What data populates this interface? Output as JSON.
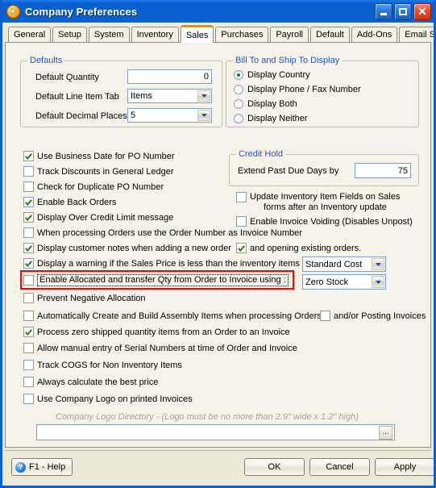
{
  "window": {
    "title": "Company Preferences",
    "app_icon": "play-circle-icon",
    "minimize_label": "Minimize",
    "maximize_label": "Maximize",
    "close_label": "Close"
  },
  "tabs": [
    {
      "label": "General",
      "active": false
    },
    {
      "label": "Setup",
      "active": false
    },
    {
      "label": "System",
      "active": false
    },
    {
      "label": "Inventory",
      "active": false
    },
    {
      "label": "Sales",
      "active": true
    },
    {
      "label": "Purchases",
      "active": false
    },
    {
      "label": "Payroll",
      "active": false
    },
    {
      "label": "Default",
      "active": false
    },
    {
      "label": "Add-Ons",
      "active": false
    },
    {
      "label": "Email Setup",
      "active": false
    }
  ],
  "defaults_group": {
    "legend": "Defaults",
    "quantity_label": "Default Quantity",
    "quantity_value": "0",
    "line_item_tab_label": "Default Line Item Tab",
    "line_item_tab_value": "Items",
    "decimal_places_label": "Default Decimal Places",
    "decimal_places_value": "5"
  },
  "billship_group": {
    "legend": "Bill To and Ship To Display",
    "options": [
      {
        "label": "Display Country",
        "selected": true
      },
      {
        "label": "Display Phone / Fax Number",
        "selected": false
      },
      {
        "label": "Display Both",
        "selected": false
      },
      {
        "label": "Display Neither",
        "selected": false
      }
    ]
  },
  "credit_hold_group": {
    "legend": "Credit Hold",
    "extend_label": "Extend Past Due Days by",
    "extend_value": "75"
  },
  "left_checkboxes": [
    {
      "label": "Use Business Date for PO Number",
      "checked": true
    },
    {
      "label": "Track Discounts in General Ledger",
      "checked": false
    },
    {
      "label": "Check for Duplicate PO Number",
      "checked": false
    },
    {
      "label": "Enable Back Orders",
      "checked": true
    },
    {
      "label": "Display Over Credit Limit message",
      "checked": true
    },
    {
      "label": "When processing Orders use the Order Number as Invoice Number",
      "checked": false
    }
  ],
  "right_checkboxes": [
    {
      "label": "Update Inventory Item Fields on Sales",
      "label2": "forms after an Inventory update",
      "checked": false
    },
    {
      "label": "Enable Invoice Voiding (Disables Unpost)",
      "checked": false
    }
  ],
  "customer_notes_row": {
    "label": "Display customer notes when adding a new order",
    "checked": true,
    "second_label": "and opening existing orders.",
    "second_checked": true
  },
  "sales_price_row": {
    "label": "Display a warning if the Sales Price is less than the inventory items",
    "checked": true,
    "dropdown_value": "Standard Cost"
  },
  "allocated_row": {
    "label": "Enable Allocated and transfer Qty from Order to Invoice using :",
    "checked": false,
    "dropdown_value": "Zero Stock",
    "highlight_color": "#ff0000",
    "focused": true
  },
  "bottom_checkboxes": [
    {
      "label": "Prevent Negative Allocation",
      "checked": false
    },
    {
      "label": "Automatically Create and Build Assembly Items when processing Orders",
      "checked": false,
      "second_label": "and/or Posting Invoices",
      "second_checked": false
    },
    {
      "label": "Process zero shipped quantity items from an Order to an Invoice",
      "checked": true
    },
    {
      "label": "Allow manual entry of Serial Numbers at time of Order and Invoice",
      "checked": false
    },
    {
      "label": "Track COGS for Non Inventory Items",
      "checked": false
    },
    {
      "label": "Always calculate the best price",
      "checked": false
    },
    {
      "label": "Use Company Logo on printed Invoices",
      "checked": false
    }
  ],
  "logo": {
    "caption": "Company Logo Directory - (Logo must be no more than 2.9\" wide x 1.2\" high)",
    "path_value": "",
    "browse_label": "..."
  },
  "footer": {
    "help_label": "F1 - Help",
    "help_icon": "question-mark-icon",
    "ok_label": "OK",
    "cancel_label": "Cancel",
    "apply_label": "Apply"
  },
  "colors": {
    "titlebar": "#0a5fd0",
    "panel": "#f4f2e9",
    "dialog": "#ece9d8",
    "legend_text": "#2a55b8",
    "accent_tab": "#f29100",
    "check_green": "#1a7a1a",
    "highlight": "#ff0000"
  }
}
